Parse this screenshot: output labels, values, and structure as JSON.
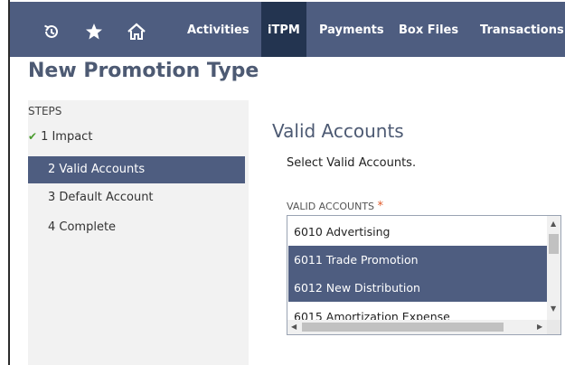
{
  "nav": {
    "icons": [
      "recent-icon",
      "star-icon",
      "home-icon"
    ],
    "items": [
      "Activities",
      "iTPM",
      "Payments",
      "Box Files",
      "Transactions"
    ],
    "active": "iTPM"
  },
  "page": {
    "title": "New Promotion Type"
  },
  "steps": {
    "heading": "STEPS",
    "items": [
      "1 Impact",
      "2 Valid Accounts",
      "3 Default Account",
      "4 Complete"
    ]
  },
  "main": {
    "section_title": "Valid Accounts",
    "instructions": "Select Valid Accounts.",
    "field_label": "VALID ACCOUNTS",
    "required_mark": "*",
    "options": [
      "6010 Advertising",
      "6011 Trade Promotion",
      "6012 New Distribution",
      "6015 Amortization Expense"
    ],
    "selected": [
      "6011 Trade Promotion",
      "6012 New Distribution"
    ]
  },
  "colors": {
    "nav_bg": "#4e5d80",
    "nav_active": "#233450",
    "title": "#4d5a73",
    "check": "#4a9b2e",
    "required": "#e05a2a"
  }
}
